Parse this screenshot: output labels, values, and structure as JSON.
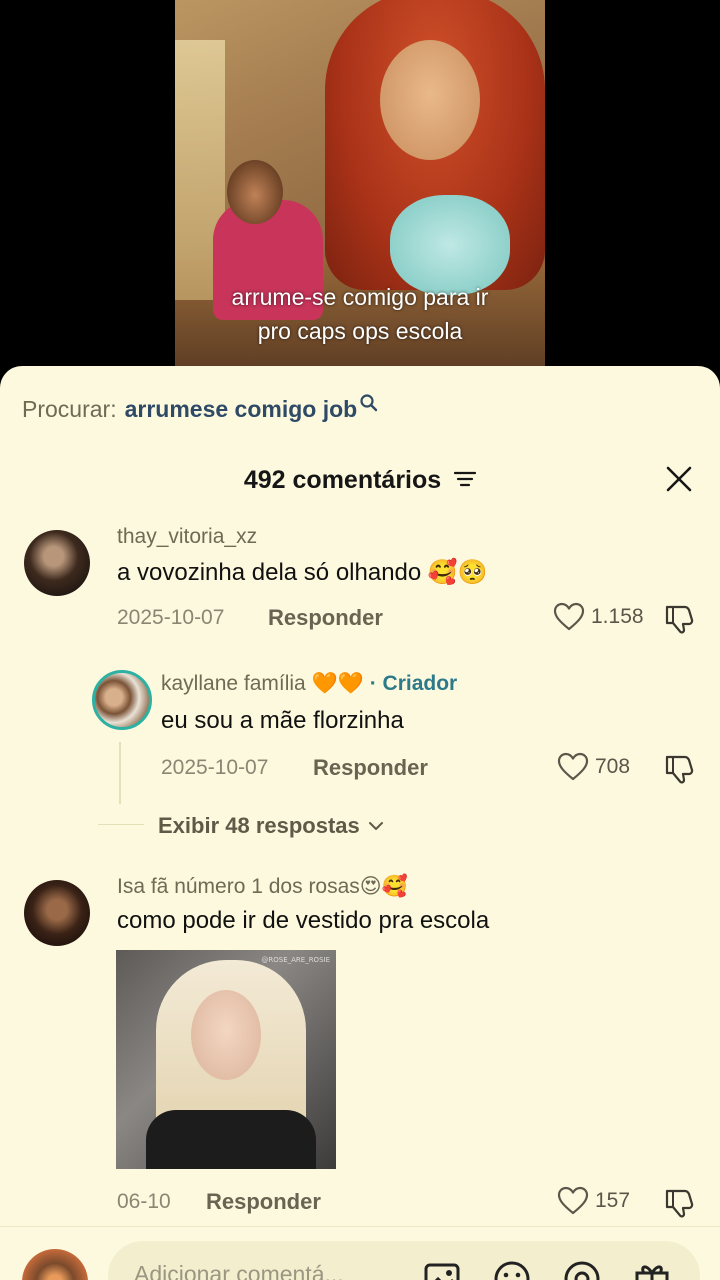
{
  "video": {
    "caption_line1": "arrume-se comigo para ir",
    "caption_line2": "pro caps ops escola"
  },
  "search": {
    "prefix": "Procurar:",
    "term": "arrumese comigo job"
  },
  "header": {
    "title": "492 comentários"
  },
  "comments": [
    {
      "username": "thay_vitoria_xz",
      "text": "a vovozinha dela só olhando 🥰🥺",
      "date": "2025-10-07",
      "reply_label": "Responder",
      "likes": "1.158"
    },
    {
      "username": "kayllane família",
      "hearts": "🧡🧡",
      "creator_tag": "· Criador",
      "text": "eu sou a mãe florzinha",
      "date": "2025-10-07",
      "reply_label": "Responder",
      "likes": "708"
    },
    {
      "username": "Isa fã número 1 dos rosas😍🥰",
      "text": "como pode ir de vestido pra escola",
      "date": "06-10",
      "reply_label": "Responder",
      "likes": "157"
    }
  ],
  "view_replies": {
    "label": "Exibir 48 respostas"
  },
  "attachment": {
    "watermark": "@ROSE_ARE_ROSIE"
  },
  "input": {
    "placeholder": "Adicionar comentá..."
  },
  "colors": {
    "sheet_bg": "#fdf9de",
    "creator_accent": "#2c7a8a",
    "avatar_ring": "#2db1a2"
  },
  "icons": [
    "search-icon",
    "sort-icon",
    "close-icon",
    "heart-icon",
    "dislike-icon",
    "chevron-down-icon",
    "image-icon",
    "emoji-icon",
    "mention-icon",
    "gift-icon"
  ]
}
